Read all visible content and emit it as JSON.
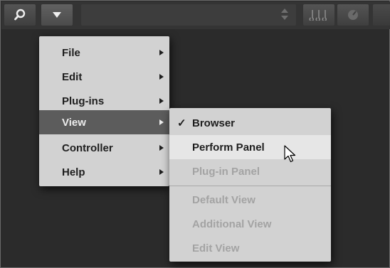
{
  "toolbar": {
    "search_icon": "search-icon",
    "dropdown_icon": "triangle-down-icon",
    "stepper_icon": "up-down-stepper-icon",
    "notes_icon": "music-notes-icon",
    "metronome_icon": "metronome-icon"
  },
  "menu": {
    "items": [
      {
        "label": "File",
        "has_submenu": true
      },
      {
        "label": "Edit",
        "has_submenu": true
      },
      {
        "label": "Plug-ins",
        "has_submenu": true
      },
      {
        "label": "View",
        "has_submenu": true,
        "active": true
      },
      {
        "label": "Controller",
        "has_submenu": true
      },
      {
        "label": "Help",
        "has_submenu": true
      }
    ]
  },
  "submenu": {
    "items": [
      {
        "label": "Browser",
        "checked": true,
        "enabled": true
      },
      {
        "label": "Perform Panel",
        "checked": false,
        "enabled": true,
        "hovered": true
      },
      {
        "label": "Plug-in Panel",
        "checked": false,
        "enabled": false
      },
      {
        "label": "Default View",
        "checked": false,
        "enabled": false
      },
      {
        "label": "Additional View",
        "checked": false,
        "enabled": false
      },
      {
        "label": "Edit View",
        "checked": false,
        "enabled": false
      }
    ],
    "check_glyph": "✓"
  },
  "colors": {
    "menu_bg": "#d2d2d2",
    "active_bg": "#5c5c5c",
    "hover_bg": "#e6e6e6",
    "disabled_text": "#a3a3a3",
    "toolbar_bg": "#343434"
  }
}
